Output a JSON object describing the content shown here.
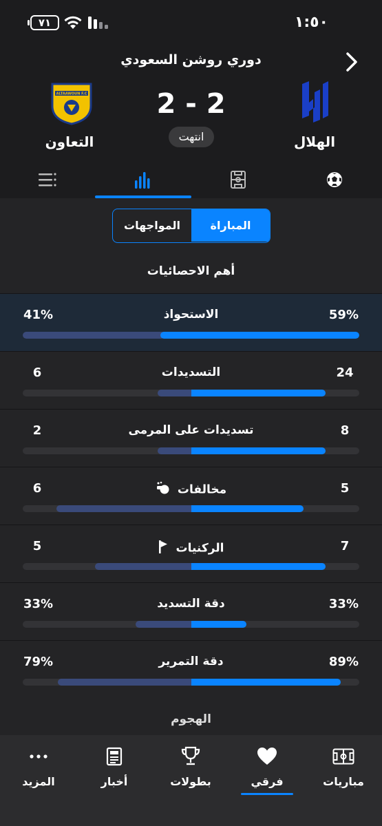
{
  "status_bar": {
    "time": "١:٥٠",
    "battery": "٧١"
  },
  "header": {
    "league": "دوري روشن السعودي",
    "home_team": "الهلال",
    "away_team": "التعاون",
    "score": "2 - 2",
    "status": "انتهت",
    "away_logo_text": "ALTAAWOUN F.C"
  },
  "tabs": [
    {
      "name": "events-icon"
    },
    {
      "name": "lineup-icon"
    },
    {
      "name": "stats-icon",
      "active": true
    },
    {
      "name": "list-icon"
    }
  ],
  "segmented": {
    "match": "المباراة",
    "h2h": "المواجهات"
  },
  "section_title": "أهم الاحصائيات",
  "stats": [
    {
      "label": "الاستحواذ",
      "home": "59%",
      "away": "41%",
      "home_value": 59,
      "away_value": 41,
      "highlight": true,
      "mode": "split"
    },
    {
      "label": "التسديدات",
      "home": "24",
      "away": "6",
      "home_value": 24,
      "away_value": 6,
      "mode": "center"
    },
    {
      "label": "تسديدات على المرمى",
      "home": "8",
      "away": "2",
      "home_value": 8,
      "away_value": 2,
      "mode": "center"
    },
    {
      "label": "مخالفات",
      "home": "5",
      "away": "6",
      "home_value": 5,
      "away_value": 6,
      "icon": "whistle-icon",
      "mode": "center"
    },
    {
      "label": "الركنيات",
      "home": "7",
      "away": "5",
      "home_value": 7,
      "away_value": 5,
      "icon": "corner-flag-icon",
      "mode": "center"
    },
    {
      "label": "دقة التسديد",
      "home": "33%",
      "away": "33%",
      "home_value": 33,
      "away_value": 33,
      "mode": "center"
    },
    {
      "label": "دقة التمرير",
      "home": "89%",
      "away": "79%",
      "home_value": 89,
      "away_value": 79,
      "mode": "center"
    }
  ],
  "attack_title": "الهجوم",
  "bottom_nav": [
    {
      "label": "مباريات",
      "icon": "pitch-icon"
    },
    {
      "label": "فرقي",
      "icon": "heart-icon",
      "active": true
    },
    {
      "label": "بطولات",
      "icon": "trophy-icon"
    },
    {
      "label": "أخبار",
      "icon": "news-icon"
    },
    {
      "label": "المزيد",
      "icon": "more-icon"
    }
  ],
  "colors": {
    "accent": "#0a84ff",
    "away_bar": "#3a4a7a",
    "background": "#1c1c1e"
  }
}
